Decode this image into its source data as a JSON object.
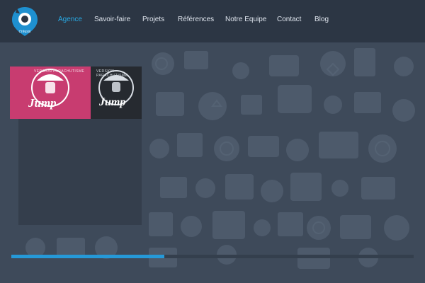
{
  "brand": {
    "logo_label": "c'réussi"
  },
  "nav": {
    "items": [
      {
        "label": "Agence",
        "active": true
      },
      {
        "label": "Savoir-faire",
        "active": false
      },
      {
        "label": "Projets",
        "active": false
      },
      {
        "label": "Références",
        "active": false
      },
      {
        "label": "Notre Equipe",
        "active": false
      },
      {
        "label": "Contact",
        "active": false
      },
      {
        "label": "Blog",
        "active": false
      }
    ]
  },
  "featured": {
    "shirt_word": "Jump",
    "shirt_text": "VERSION PARACHUTISME"
  },
  "slider": {
    "progress": 0.38
  },
  "colors": {
    "accent": "#28a9e4",
    "topbar": "#2c3644",
    "background": "#3e4a5a",
    "shirt_pink": "#c83c70",
    "shirt_black": "#262a30"
  }
}
